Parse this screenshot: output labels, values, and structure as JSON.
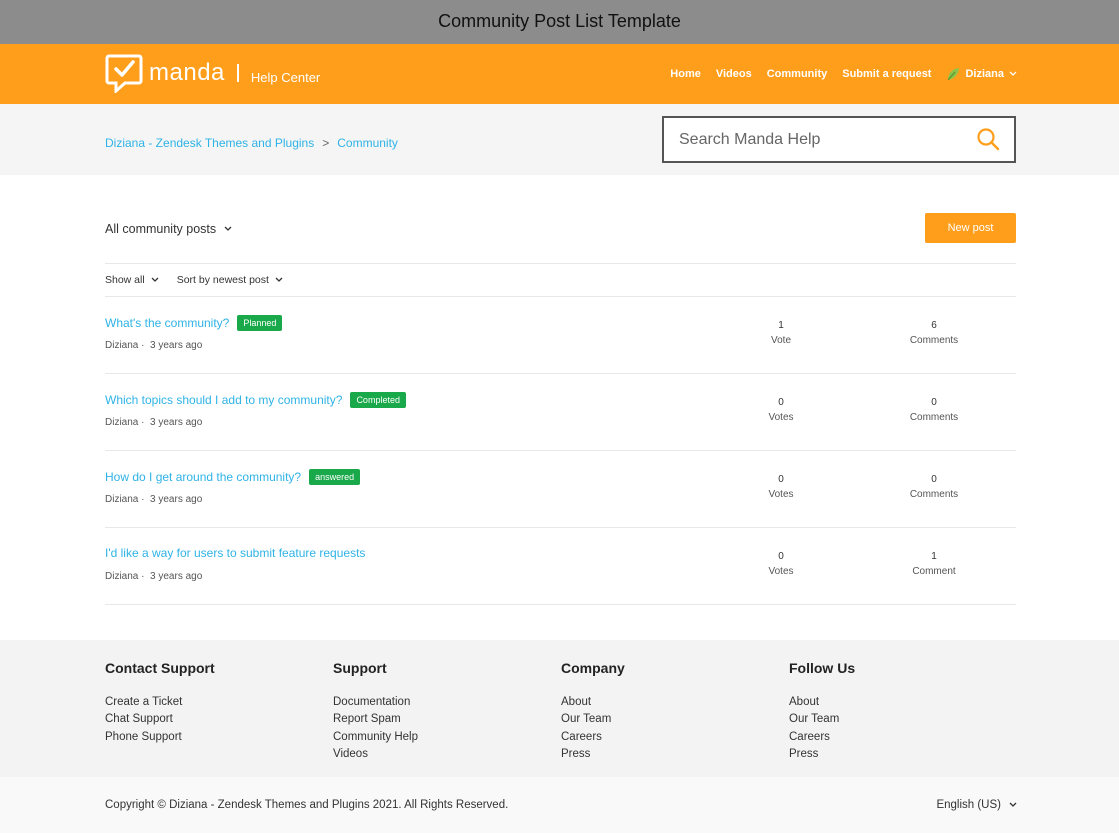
{
  "window": {
    "title": "Community Post List Template"
  },
  "header": {
    "logo_text": "manda",
    "logo_sub": "Help Center",
    "nav": [
      "Home",
      "Videos",
      "Community",
      "Submit a request"
    ],
    "user": "Diziana"
  },
  "breadcrumb": {
    "items": [
      "Diziana - Zendesk Themes and Plugins",
      "Community"
    ],
    "separator": ">"
  },
  "search": {
    "placeholder": "Search Manda Help"
  },
  "filter": {
    "title": "All community posts",
    "new_post": "New post",
    "show": "Show all",
    "sort": "Sort by newest post"
  },
  "posts": [
    {
      "title": "What's the community?",
      "badge": "Planned",
      "author": "Diziana",
      "age": "3 years ago",
      "votes": "1",
      "votes_label": "Vote",
      "comments": "6",
      "comments_label": "Comments"
    },
    {
      "title": "Which topics should I add to my community?",
      "badge": "Completed",
      "author": "Diziana",
      "age": "3 years ago",
      "votes": "0",
      "votes_label": "Votes",
      "comments": "0",
      "comments_label": "Comments"
    },
    {
      "title": "How do I get around the community?",
      "badge": "answered",
      "author": "Diziana",
      "age": "3 years ago",
      "votes": "0",
      "votes_label": "Votes",
      "comments": "0",
      "comments_label": "Comments"
    },
    {
      "title": "I'd like a way for users to submit feature requests",
      "badge": "",
      "author": "Diziana",
      "age": "3 years ago",
      "votes": "0",
      "votes_label": "Votes",
      "comments": "1",
      "comments_label": "Comment"
    }
  ],
  "footer": {
    "columns": [
      {
        "heading": "Contact Support",
        "links": [
          "Create a Ticket",
          "Chat Support",
          "Phone Support"
        ]
      },
      {
        "heading": "Support",
        "links": [
          "Documentation",
          "Report Spam",
          "Community Help",
          "Videos"
        ]
      },
      {
        "heading": "Company",
        "links": [
          "About",
          "Our Team",
          "Careers",
          "Press"
        ]
      },
      {
        "heading": "Follow Us",
        "links": [
          "About",
          "Our Team",
          "Careers",
          "Press"
        ]
      }
    ],
    "copyright": "Copyright © Diziana - Zendesk Themes and Plugins  2021. All Rights Reserved.",
    "language": "English (US)"
  },
  "colors": {
    "brand": "#ff9e1b",
    "link": "#2fb3e6",
    "badge": "#19a84a"
  },
  "icons": [
    "manda-logo-icon",
    "leaf-icon",
    "search-icon",
    "chevron-down-icon"
  ]
}
